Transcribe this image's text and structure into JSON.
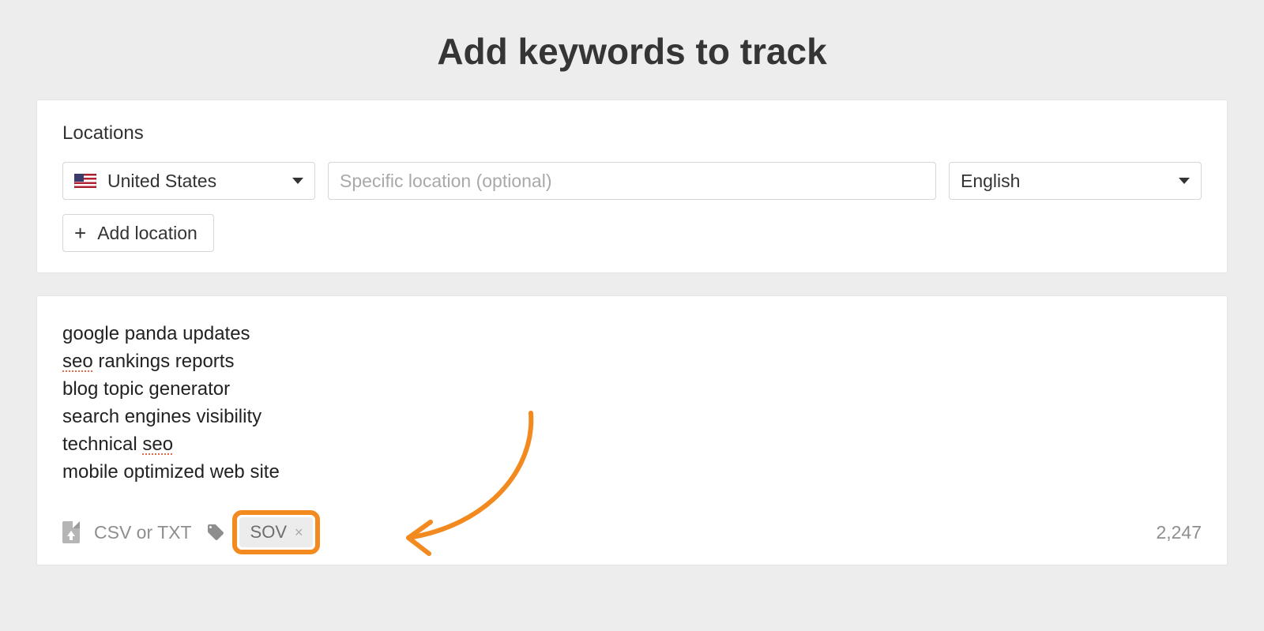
{
  "title": "Add keywords to track",
  "locations": {
    "label": "Locations",
    "country": "United States",
    "specific_placeholder": "Specific location (optional)",
    "language": "English",
    "add_location_label": "Add location"
  },
  "keywords": {
    "lines": [
      "google panda updates",
      "seo rankings reports",
      "blog topic generator",
      "search engines visibility",
      "technical seo",
      "mobile optimized web site"
    ],
    "upload_label": "CSV or TXT",
    "tag": "SOV",
    "char_counter": "2,247"
  }
}
